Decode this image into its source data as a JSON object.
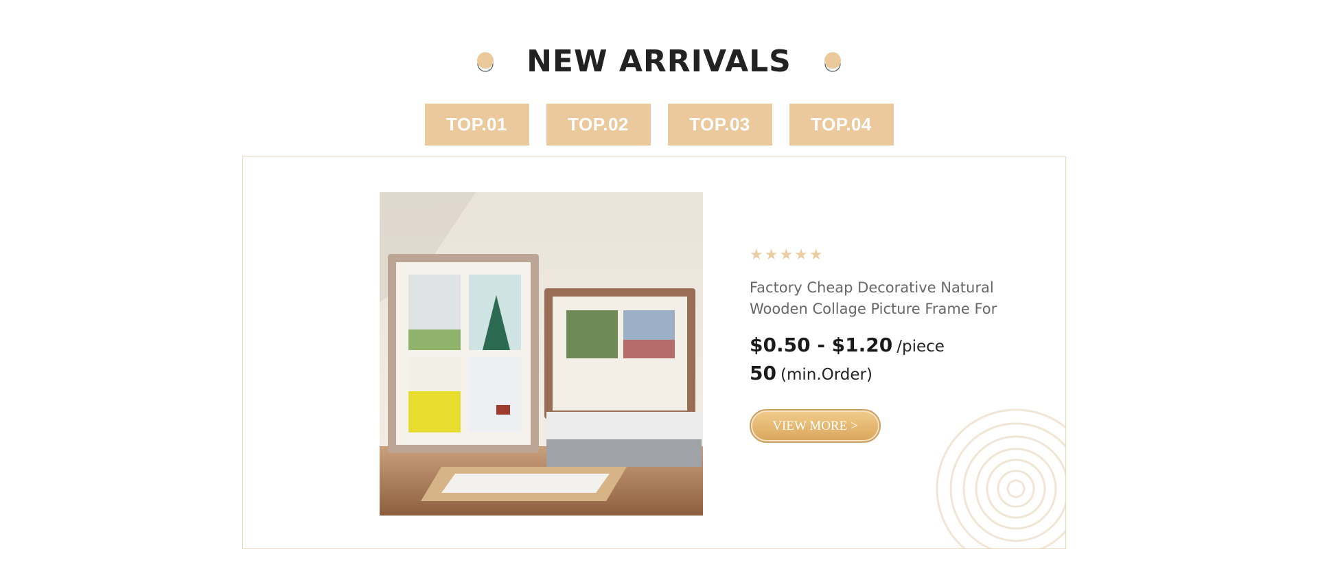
{
  "section": {
    "title": "NEW ARRIVALS"
  },
  "tabs": [
    {
      "label": "TOP.01"
    },
    {
      "label": "TOP.02"
    },
    {
      "label": "TOP.03"
    },
    {
      "label": "TOP.04"
    }
  ],
  "product": {
    "rating_stars": "★★★★★",
    "name_line1": "Factory Cheap Decorative Natural",
    "name_line2": "Wooden Collage Picture Frame For",
    "price_range": "$0.50 - $1.20",
    "price_unit": "/piece",
    "min_order_qty": "50",
    "min_order_label": "(min.Order)",
    "view_more_label": "VIEW MORE >",
    "image_icon": "product-photo-picture-frames"
  },
  "colors": {
    "accent": "#ebc99c",
    "title": "#222222",
    "panel_border": "#e6d8bf",
    "button": "#d9a65c"
  }
}
